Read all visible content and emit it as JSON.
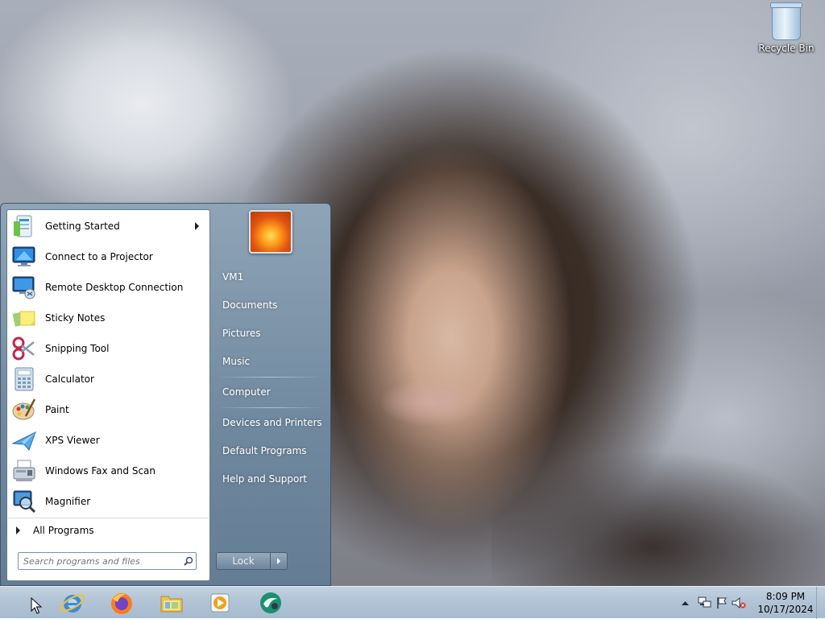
{
  "desktop": {
    "icons": [
      {
        "label": "Recycle Bin",
        "icon": "recycle-bin-icon"
      }
    ]
  },
  "start_menu": {
    "programs": [
      {
        "label": "Getting Started",
        "icon": "getting-started-icon",
        "has_submenu": true
      },
      {
        "label": "Connect to a Projector",
        "icon": "projector-icon"
      },
      {
        "label": "Remote Desktop Connection",
        "icon": "remote-desktop-icon"
      },
      {
        "label": "Sticky Notes",
        "icon": "sticky-notes-icon"
      },
      {
        "label": "Snipping Tool",
        "icon": "scissors-icon"
      },
      {
        "label": "Calculator",
        "icon": "calculator-icon"
      },
      {
        "label": "Paint",
        "icon": "paint-palette-icon"
      },
      {
        "label": "XPS Viewer",
        "icon": "xps-viewer-icon"
      },
      {
        "label": "Windows Fax and Scan",
        "icon": "fax-scan-icon"
      },
      {
        "label": "Magnifier",
        "icon": "magnifier-icon"
      }
    ],
    "all_programs_label": "All Programs",
    "search_placeholder": "Search programs and files",
    "places": [
      {
        "label": "VM1"
      },
      {
        "label": "Documents"
      },
      {
        "label": "Pictures"
      },
      {
        "label": "Music"
      },
      {
        "label": "Computer"
      },
      {
        "label": "Devices and Printers"
      },
      {
        "label": "Default Programs"
      },
      {
        "label": "Help and Support"
      }
    ],
    "lock_label": "Lock"
  },
  "taskbar": {
    "pinned": [
      {
        "icon": "internet-explorer-icon"
      },
      {
        "icon": "firefox-icon"
      },
      {
        "icon": "file-explorer-icon"
      },
      {
        "icon": "media-player-icon"
      },
      {
        "icon": "app-swirl-icon"
      }
    ],
    "tray_icons": [
      "show-hidden-icons-icon",
      "network-icon",
      "action-center-flag-icon",
      "volume-muted-icon"
    ],
    "clock": {
      "time": "8:09 PM",
      "date": "10/17/2024"
    }
  }
}
